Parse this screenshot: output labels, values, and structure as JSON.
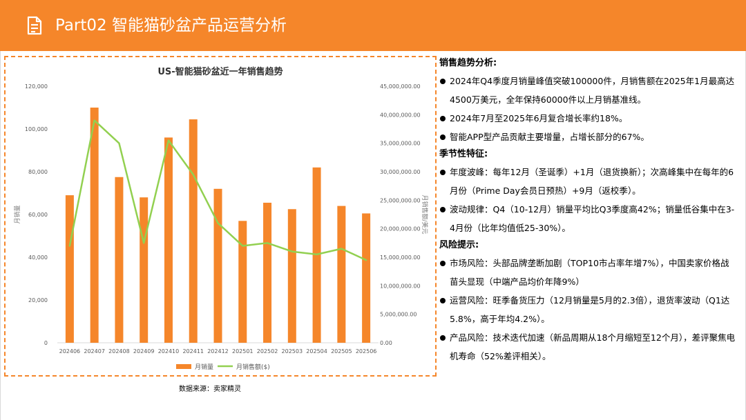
{
  "header": {
    "title": "Part02 智能猫砂盆产品运营分析",
    "icon": "document-icon",
    "color": "#F5862A"
  },
  "chart_data": {
    "type": "bar",
    "title": "US-智能猫砂盆近一年销售趋势",
    "categories": [
      "202406",
      "202407",
      "202408",
      "202409",
      "202410",
      "202411",
      "202412",
      "202501",
      "202502",
      "202503",
      "202504",
      "202505",
      "202506"
    ],
    "series": [
      {
        "name": "月销量",
        "type": "bar",
        "axis": "left",
        "color": "#F5862A",
        "values": [
          69000,
          110000,
          77500,
          68000,
          96000,
          104500,
          72000,
          57000,
          65500,
          62500,
          82000,
          64000,
          60500
        ]
      },
      {
        "name": "月销售额($)",
        "type": "line",
        "axis": "right",
        "color": "#92D050",
        "values": [
          17000000,
          39000000,
          35000000,
          17500000,
          35500000,
          29500000,
          21000000,
          17000000,
          17500000,
          16000000,
          15500000,
          16500000,
          14500000
        ]
      }
    ],
    "ylabel": "月销量",
    "ylabel_right": "月销售额/美元",
    "ylim": [
      0,
      120000
    ],
    "ylim_right": [
      0,
      45000000
    ],
    "yticks": [
      "0",
      "20,000",
      "40,000",
      "60,000",
      "80,000",
      "100,000",
      "120,000"
    ],
    "yticks_right": [
      "0.00",
      "5,000,000.00",
      "10,000,000.00",
      "15,000,000.00",
      "20,000,000.00",
      "25,000,000.00",
      "30,000,000.00",
      "35,000,000.00",
      "40,000,000.00",
      "45,000,000.00"
    ],
    "grid": false,
    "legend": "bottom"
  },
  "source_text": "数据来源：卖家精灵",
  "analysis": {
    "sections": [
      {
        "heading": "销售趋势分析:",
        "bullets": [
          "2024年Q4季度月销量峰值突破100000件，月销售额在2025年1月最高达4500万美元，全年保持60000件以上月销基准线。",
          "2024年7月至2025年6月复合增长率约18%。",
          "智能APP型产品贡献主要增量，占增长部分的67%。"
        ]
      },
      {
        "heading": "季节性特征:",
        "bullets": [
          "年度波峰：每年12月（圣诞季）+1月（退货换新）；次高峰集中在每年的6月份（Prime Day会员日预热）+9月（返校季）。",
          "波动规律：Q4（10-12月）销量平均比Q3季度高42%；销量低谷集中在3-4月份（比年均值低25-30%）。"
        ]
      },
      {
        "heading": "风险提示:",
        "bullets": [
          "市场风险：头部品牌垄断加剧（TOP10市占率年增7%），中国卖家价格战苗头显现（中端产品均价年降9%）",
          "运营风险：旺季备货压力（12月销量是5月的2.3倍），退货率波动（Q1达5.8%，高于年均4.2%）。",
          "产品风险：技术迭代加速（新品周期从18个月缩短至12个月），差评聚焦电机寿命（52%差评相关）。"
        ]
      }
    ]
  }
}
